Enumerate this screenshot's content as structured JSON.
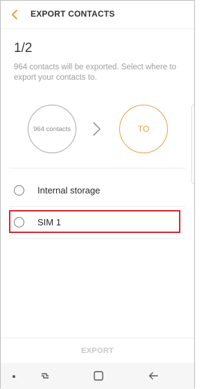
{
  "header": {
    "title": "EXPORT CONTACTS",
    "back_icon": "back-arrow-icon",
    "accent_color": "#f09c40"
  },
  "step": "1/2",
  "description": "964 contacts will be exported. Select where to export your contacts to.",
  "source": {
    "label": "964 contacts"
  },
  "destination": {
    "label": "TO"
  },
  "options": [
    {
      "label": "Internal storage",
      "selected": false
    },
    {
      "label": "SIM 1",
      "selected": false,
      "highlighted": true
    }
  ],
  "export_button": {
    "label": "EXPORT",
    "enabled": false
  },
  "navbar": {
    "icons": [
      "dot-icon",
      "recents-icon",
      "home-icon",
      "back-icon"
    ]
  }
}
